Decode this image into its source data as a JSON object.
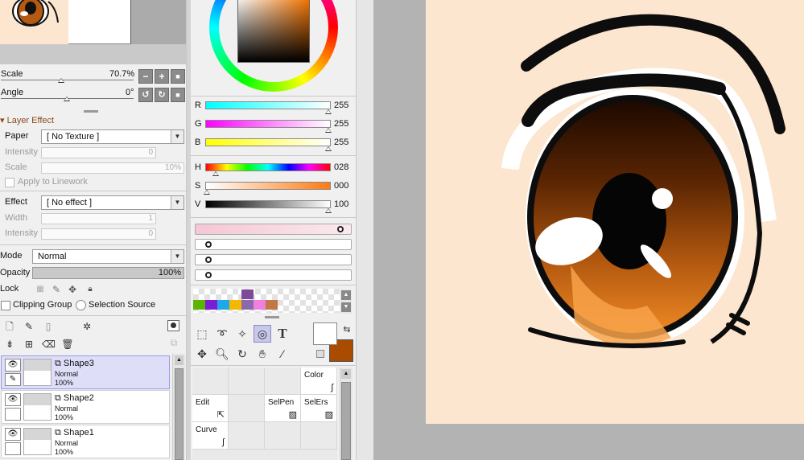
{
  "navigator": {
    "scale_label": "Scale",
    "scale_value": "70.7%",
    "angle_label": "Angle",
    "angle_value": "0°"
  },
  "layer_effect": {
    "header": "Layer Effect",
    "paper_label": "Paper",
    "paper_value": "[ No Texture ]",
    "intensity_label": "Intensity",
    "intensity_value": "0",
    "scale_label": "Scale",
    "scale_value": "10%",
    "apply_linework": "Apply to Linework",
    "effect_label": "Effect",
    "effect_value": "[ No effect ]",
    "width_label": "Width",
    "width_value": "1",
    "intensity2_label": "Intensity",
    "intensity2_value": "0"
  },
  "layer_props": {
    "mode_label": "Mode",
    "mode_value": "Normal",
    "opacity_label": "Opacity",
    "opacity_value": "100%",
    "lock_label": "Lock",
    "clipping_group": "Clipping Group",
    "selection_source": "Selection Source"
  },
  "layers": [
    {
      "name": "Shape3",
      "mode": "Normal",
      "opacity": "100%",
      "selected": true
    },
    {
      "name": "Shape2",
      "mode": "Normal",
      "opacity": "100%",
      "selected": false
    },
    {
      "name": "Shape1",
      "mode": "Normal",
      "opacity": "100%",
      "selected": false
    }
  ],
  "color": {
    "R": {
      "label": "R",
      "value": "255"
    },
    "G": {
      "label": "G",
      "value": "255"
    },
    "B": {
      "label": "B",
      "value": "255"
    },
    "H": {
      "label": "H",
      "value": "028"
    },
    "S": {
      "label": "S",
      "value": "000"
    },
    "V": {
      "label": "V",
      "value": "100"
    },
    "foreground": "#ffffff",
    "background": "#a94c00"
  },
  "swatches": [
    "#5db400",
    "#7b1dd6",
    "#1fa8e8",
    "#f5b800",
    "#8a6aac",
    "#f07fe0",
    "#c07844"
  ],
  "swatch_extra": "#7e4b9a",
  "brush_grid": {
    "color_label": "Color",
    "edit_label": "Edit",
    "selpen_label": "SelPen",
    "selers_label": "SelErs",
    "curve_label": "Curve"
  },
  "icons": {
    "eye": "eye-icon",
    "pen": "pen-icon",
    "trash": "trash-icon",
    "text": "text-tool-icon"
  }
}
